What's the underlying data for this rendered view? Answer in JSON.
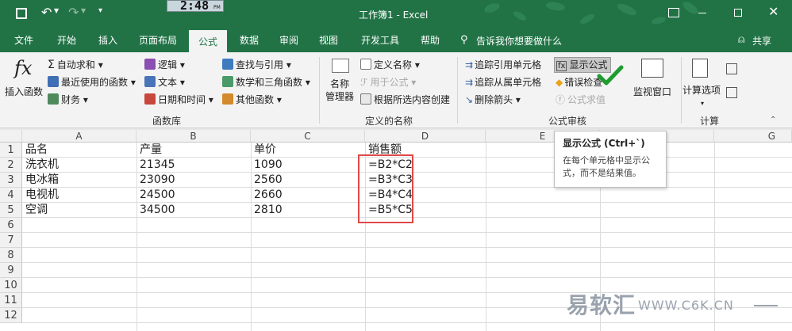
{
  "titlebar": {
    "clock": "2:48",
    "clock_ampm": "PM",
    "title": "工作簿1 - Excel"
  },
  "tabs": [
    "文件",
    "开始",
    "插入",
    "页面布局",
    "公式",
    "数据",
    "审阅",
    "视图",
    "开发工具",
    "帮助"
  ],
  "tell_me": "告诉我你想要做什么",
  "share": "共享",
  "ribbon": {
    "insert_fn": "插入函数",
    "library": {
      "autosum": "自动求和",
      "recent": "最近使用的函数",
      "finance": "财务",
      "logic": "逻辑",
      "text": "文本",
      "datetime": "日期和时间",
      "lookup": "查找与引用",
      "math": "数学和三角函数",
      "more": "其他函数",
      "group_label": "函数库"
    },
    "names": {
      "name_manager_1": "名称",
      "name_manager_2": "管理器",
      "define": "定义名称",
      "use_in": "用于公式",
      "create": "根据所选内容创建",
      "group_label": "定义的名称"
    },
    "audit": {
      "trace_prec": "追踪引用单元格",
      "trace_dep": "追踪从属单元格",
      "remove_arrows": "删除箭头",
      "show_formulas": "显示公式",
      "error_check": "错误检查",
      "evaluate": "公式求值",
      "watch": "监视窗口",
      "group_label": "公式审核"
    },
    "calc": {
      "options": "计算选项",
      "group_label": "计算"
    }
  },
  "sheet": {
    "columns": [
      "A",
      "B",
      "C",
      "D",
      "E",
      "F",
      "G"
    ],
    "rows": [
      "1",
      "2",
      "3",
      "4",
      "5",
      "6",
      "7",
      "8",
      "9",
      "10",
      "11",
      "12"
    ],
    "header": [
      "品名",
      "产量",
      "单价",
      "销售额"
    ],
    "data": [
      [
        "洗衣机",
        "21345",
        "1090",
        "=B2*C2"
      ],
      [
        "电冰箱",
        "23090",
        "2560",
        "=B3*C3"
      ],
      [
        "电视机",
        "24500",
        "2660",
        "=B4*C4"
      ],
      [
        "空调",
        "34500",
        "2810",
        "=B5*C5"
      ]
    ]
  },
  "tooltip": {
    "title": "显示公式 (Ctrl+`)",
    "body_1": "在每个单元格中显示公",
    "body_2": "式，而不是结果值。"
  },
  "watermark": {
    "brand": "易软汇",
    "url": "WWW.C6K.CN"
  }
}
